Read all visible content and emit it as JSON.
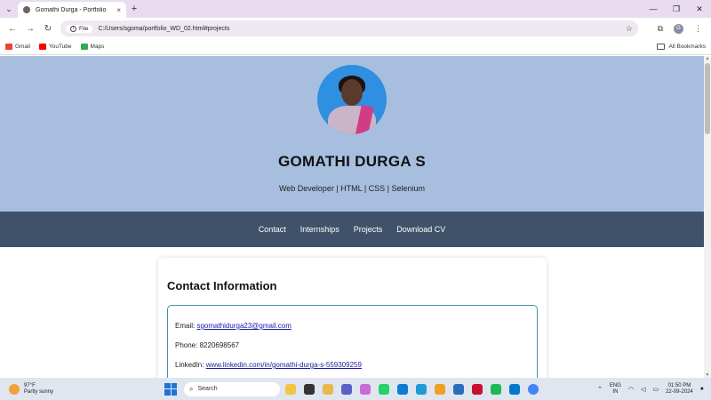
{
  "browser": {
    "tab_title": "Gomathi Durga - Portfolio",
    "tab_close": "×",
    "new_tab": "+",
    "url_chip": "File",
    "url": "C:/Users/sgoma/portfolio_WD_02.html#projects",
    "profile_initial": "G",
    "bookmarks": [
      "Gmail",
      "YouTube",
      "Maps"
    ],
    "all_bookmarks": "All Bookmarks"
  },
  "hero": {
    "name": "GOMATHI DURGA S",
    "tagline": "Web Developer | HTML | CSS | Selenium"
  },
  "nav": {
    "items": [
      "Contact",
      "Internships",
      "Projects",
      "Download CV"
    ]
  },
  "contact": {
    "heading": "Contact Information",
    "email_label": "Email:",
    "email": "sgomathidurga23@gmail.com",
    "phone_label": "Phone:",
    "phone": "8220698567",
    "linkedin_label": "LinkedIn:",
    "linkedin": "www.linkedin.com/in/gomathi-durga-s-559309259"
  },
  "taskbar": {
    "temperature": "97°F",
    "weather": "Partly sunny",
    "search_placeholder": "Search",
    "lang_top": "ENG",
    "lang_bottom": "IN",
    "time": "01:50 PM",
    "date": "22-09-2024"
  },
  "colors": {
    "hero_bg": "#a7bedf",
    "nav_bg": "#3f5269",
    "link": "#1a1aa6"
  }
}
